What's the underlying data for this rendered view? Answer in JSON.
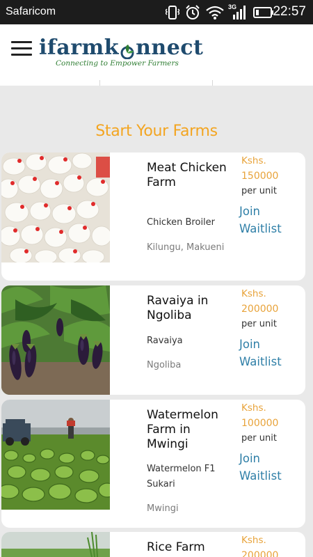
{
  "status_bar": {
    "carrier": "Safaricom",
    "network_type": "3G",
    "time": "22:57"
  },
  "header": {
    "brand": {
      "before_o": "ifarmk",
      "after_o": "nnect"
    },
    "tagline": "Connecting to Empower Farmers"
  },
  "section_title": "Start Your Farms",
  "colors": {
    "accent_orange": "#f3a521",
    "link_blue": "#2f7fa7",
    "brand_navy": "#1f4b6e",
    "brand_green": "#2e7d32"
  },
  "farms": [
    {
      "name": "Meat Chicken Farm",
      "variety": "Chicken Broiler",
      "location": "Kilungu, Makueni",
      "currency": "Kshs.",
      "price": "150000",
      "unit": "per unit",
      "action": "Join Waitlist",
      "photo": "chickens"
    },
    {
      "name": "Ravaiya in Ngoliba",
      "variety": "Ravaiya",
      "location": "Ngoliba",
      "currency": "Kshs.",
      "price": "200000",
      "unit": "per unit",
      "action": "Join Waitlist",
      "photo": "eggplants"
    },
    {
      "name": "Watermelon Farm in Mwingi",
      "variety": "Watermelon F1 Sukari",
      "location": "Mwingi",
      "currency": "Kshs.",
      "price": "100000",
      "unit": "per unit",
      "action": "Join Waitlist",
      "photo": "watermelon-field"
    },
    {
      "name": "Rice Farm",
      "currency": "Kshs.",
      "price": "200000",
      "photo": "rice-field"
    }
  ]
}
